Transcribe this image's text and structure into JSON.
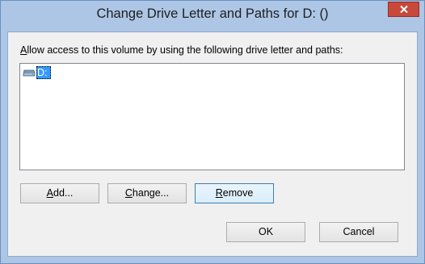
{
  "window": {
    "title": "Change Drive Letter and Paths for D: ()"
  },
  "dialog": {
    "instruction_prefix": "",
    "instruction_accel": "A",
    "instruction_rest": "llow access to this volume by using the following drive letter and paths:"
  },
  "paths": {
    "items": [
      {
        "label": "D:",
        "icon": "drive-icon",
        "selected": true
      }
    ]
  },
  "buttons": {
    "add": {
      "accel": "A",
      "accel_rest": "dd...",
      "pre": ""
    },
    "change": {
      "pre": "",
      "accel": "C",
      "accel_rest": "hange..."
    },
    "remove": {
      "pre": "",
      "accel": "R",
      "accel_rest": "emove"
    },
    "ok": "OK",
    "cancel": "Cancel"
  },
  "colors": {
    "frame": "#adc6e6",
    "close": "#c7493a",
    "selection": "#3399ff"
  }
}
